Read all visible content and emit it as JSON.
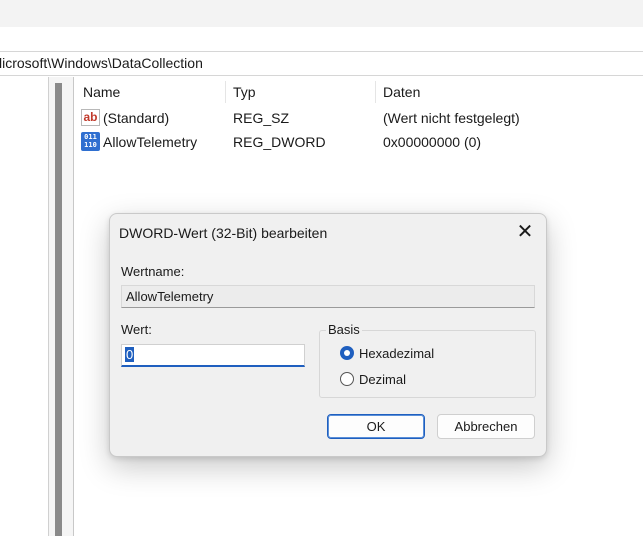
{
  "address_bar": {
    "path": "licrosoft\\Windows\\DataCollection"
  },
  "list": {
    "columns": [
      "Name",
      "Typ",
      "Daten"
    ],
    "rows": [
      {
        "icon": "string-value-icon",
        "name": "(Standard)",
        "type": "REG_SZ",
        "data": "(Wert nicht festgelegt)"
      },
      {
        "icon": "binary-value-icon",
        "name": "AllowTelemetry",
        "type": "REG_DWORD",
        "data": "0x00000000 (0)"
      }
    ]
  },
  "dialog": {
    "title": "DWORD-Wert (32-Bit) bearbeiten",
    "close_glyph": "✕",
    "name_label": "Wertname:",
    "name_value": "AllowTelemetry",
    "value_label": "Wert:",
    "value": "0",
    "base_label": "Basis",
    "base_options": [
      {
        "label": "Hexadezimal",
        "selected": true
      },
      {
        "label": "Dezimal",
        "selected": false
      }
    ],
    "ok_label": "OK",
    "cancel_label": "Abbrechen"
  },
  "colors": {
    "accent": "#1f5fbf",
    "dialog_bg": "#f0f0f0"
  }
}
